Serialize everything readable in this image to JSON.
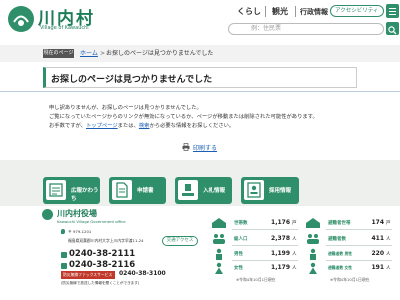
{
  "header": {
    "title": "川内村",
    "subtitle": "Village of Kawauchi",
    "nav": [
      "くらし",
      "観光",
      "行政情報"
    ],
    "accessibility_label": "アクセシビリティ",
    "search_placeholder": "例：住民票"
  },
  "breadcrumb": {
    "badge": "現在のページ",
    "home": "ホーム",
    "separator": ">",
    "current": "お探しのページは見つかりませんでした"
  },
  "page": {
    "title": "お探しのページは見つかりませんでした",
    "line1": "申し訳ありませんが、お探しのページは見つかりませんでした。",
    "line2": "ご覧になっていたページからのリンクが無効になっているか、ページが移動または削除された可能性があります。",
    "line3_prefix": "お手数ですが、",
    "line3_link1": "トップページ",
    "line3_mid": "または、",
    "line3_link2": "検索",
    "line3_suffix": "から必要な情報をお探しください。",
    "print": "印刷する"
  },
  "quick_links": [
    "広報かわうち",
    "申請書",
    "入札情報",
    "採用情報"
  ],
  "footer": {
    "name": "川内村役場",
    "name_en": "Kawauchi Village Government office",
    "postal": "〒 979-1201",
    "address": "福島県双葉郡川内村大字上川内字早渡11-24",
    "access": "交通アクセス",
    "phone1": "0240-38-2111",
    "phone2": "0240-38-2116",
    "fax_badge": "防災無線ファックスサービス",
    "fax_number": "0240-38-3100",
    "fax_note": "(防災無線で放送した情報を聞くことができます)",
    "stats_left": [
      {
        "label": "世帯数",
        "value": "1,176",
        "unit": "戸"
      },
      {
        "label": "総人口",
        "value": "2,378",
        "unit": "人"
      },
      {
        "label": "男性",
        "value": "1,199",
        "unit": "人"
      },
      {
        "label": "女性",
        "value": "1,179",
        "unit": "人"
      }
    ],
    "stats_right": [
      {
        "label": "避難者世帯",
        "value": "174",
        "unit": "戸"
      },
      {
        "label": "避難者数",
        "value": "411",
        "unit": "人"
      },
      {
        "label": "避難者数 男性",
        "value": "220",
        "unit": "人"
      },
      {
        "label": "避難者数 女性",
        "value": "191",
        "unit": "人"
      }
    ],
    "stats_note_left": "※令和4年10月1日現在",
    "stats_note_right": "※令和4年10月1日現在"
  },
  "colors": {
    "brand": "#2f8f6a",
    "link": "#1a5fb4",
    "fax": "#c0392b"
  }
}
